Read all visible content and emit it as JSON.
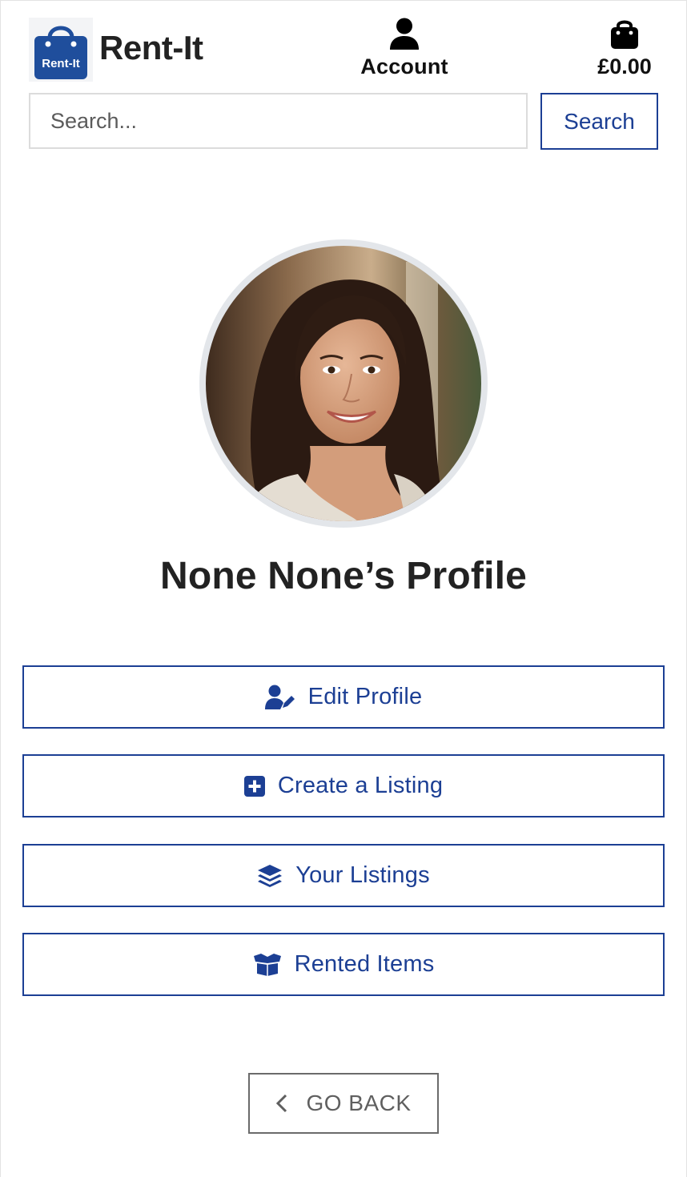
{
  "header": {
    "logo_badge_text": "Rent-It",
    "brand_name": "Rent-It",
    "account_label": "Account",
    "cart_total": "£0.00",
    "icons": {
      "logo": "shopping-bag-logo-icon",
      "account": "user-icon",
      "cart": "shopping-bag-icon"
    }
  },
  "search": {
    "placeholder": "Search...",
    "value": "",
    "button_label": "Search"
  },
  "profile": {
    "title": "None None’s Profile",
    "avatar_alt": "profile photo"
  },
  "actions": [
    {
      "label": "Edit Profile",
      "icon": "user-pen-icon"
    },
    {
      "label": "Create a Listing",
      "icon": "square-plus-icon"
    },
    {
      "label": "Your Listings",
      "icon": "layer-group-icon"
    },
    {
      "label": "Rented Items",
      "icon": "box-open-icon"
    }
  ],
  "back_button": {
    "label": "GO BACK",
    "icon": "chevron-left-icon"
  },
  "colors": {
    "accent": "#1c3f94",
    "logo_bg": "#1f4e9c",
    "back_border": "#6b6b6b",
    "text_dark": "#222222"
  }
}
